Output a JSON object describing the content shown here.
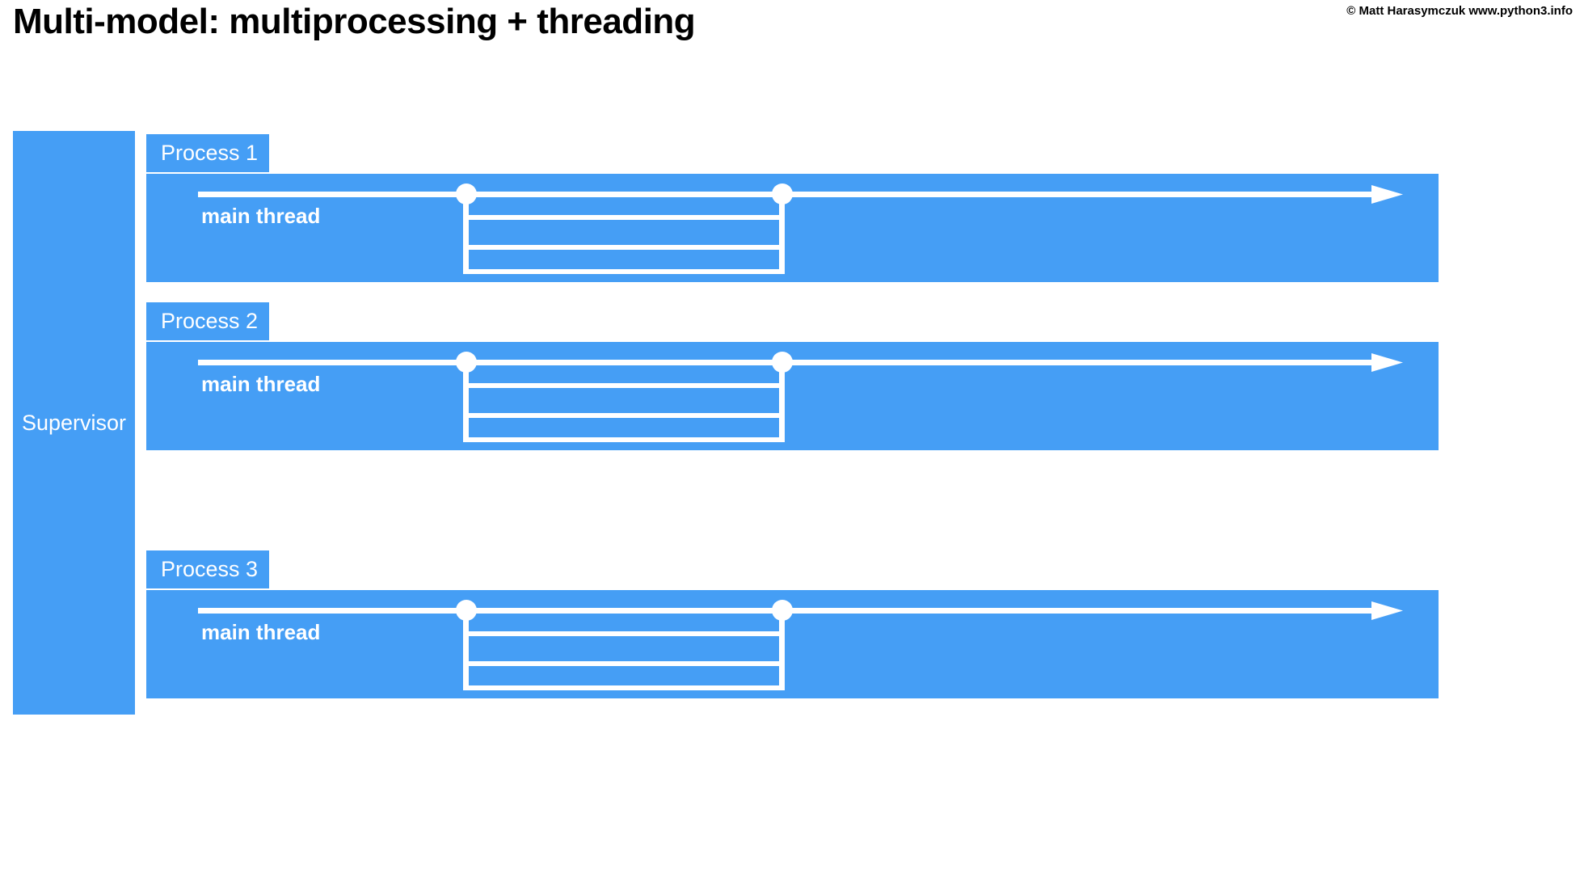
{
  "slide": {
    "title": "Multi-model: multiprocessing + threading",
    "copyright": "© Matt Harasymczuk www.python3.info"
  },
  "colors": {
    "accent_blue": "#459EF5",
    "line_white": "#FFFFFF",
    "background": "#FFFFFF",
    "title_black": "#000000"
  },
  "supervisor": {
    "label": "Supervisor"
  },
  "processes": [
    {
      "tab_label": "Process 1",
      "main_thread_label": "main thread",
      "worker_thread_count": 3,
      "fork_marker": "fork-dot",
      "join_marker": "join-dot",
      "arrow_marker": "arrowhead"
    },
    {
      "tab_label": "Process 2",
      "main_thread_label": "main thread",
      "worker_thread_count": 3,
      "fork_marker": "fork-dot",
      "join_marker": "join-dot",
      "arrow_marker": "arrowhead"
    },
    {
      "tab_label": "Process 3",
      "main_thread_label": "main thread",
      "worker_thread_count": 3,
      "fork_marker": "fork-dot",
      "join_marker": "join-dot",
      "arrow_marker": "arrowhead"
    }
  ]
}
